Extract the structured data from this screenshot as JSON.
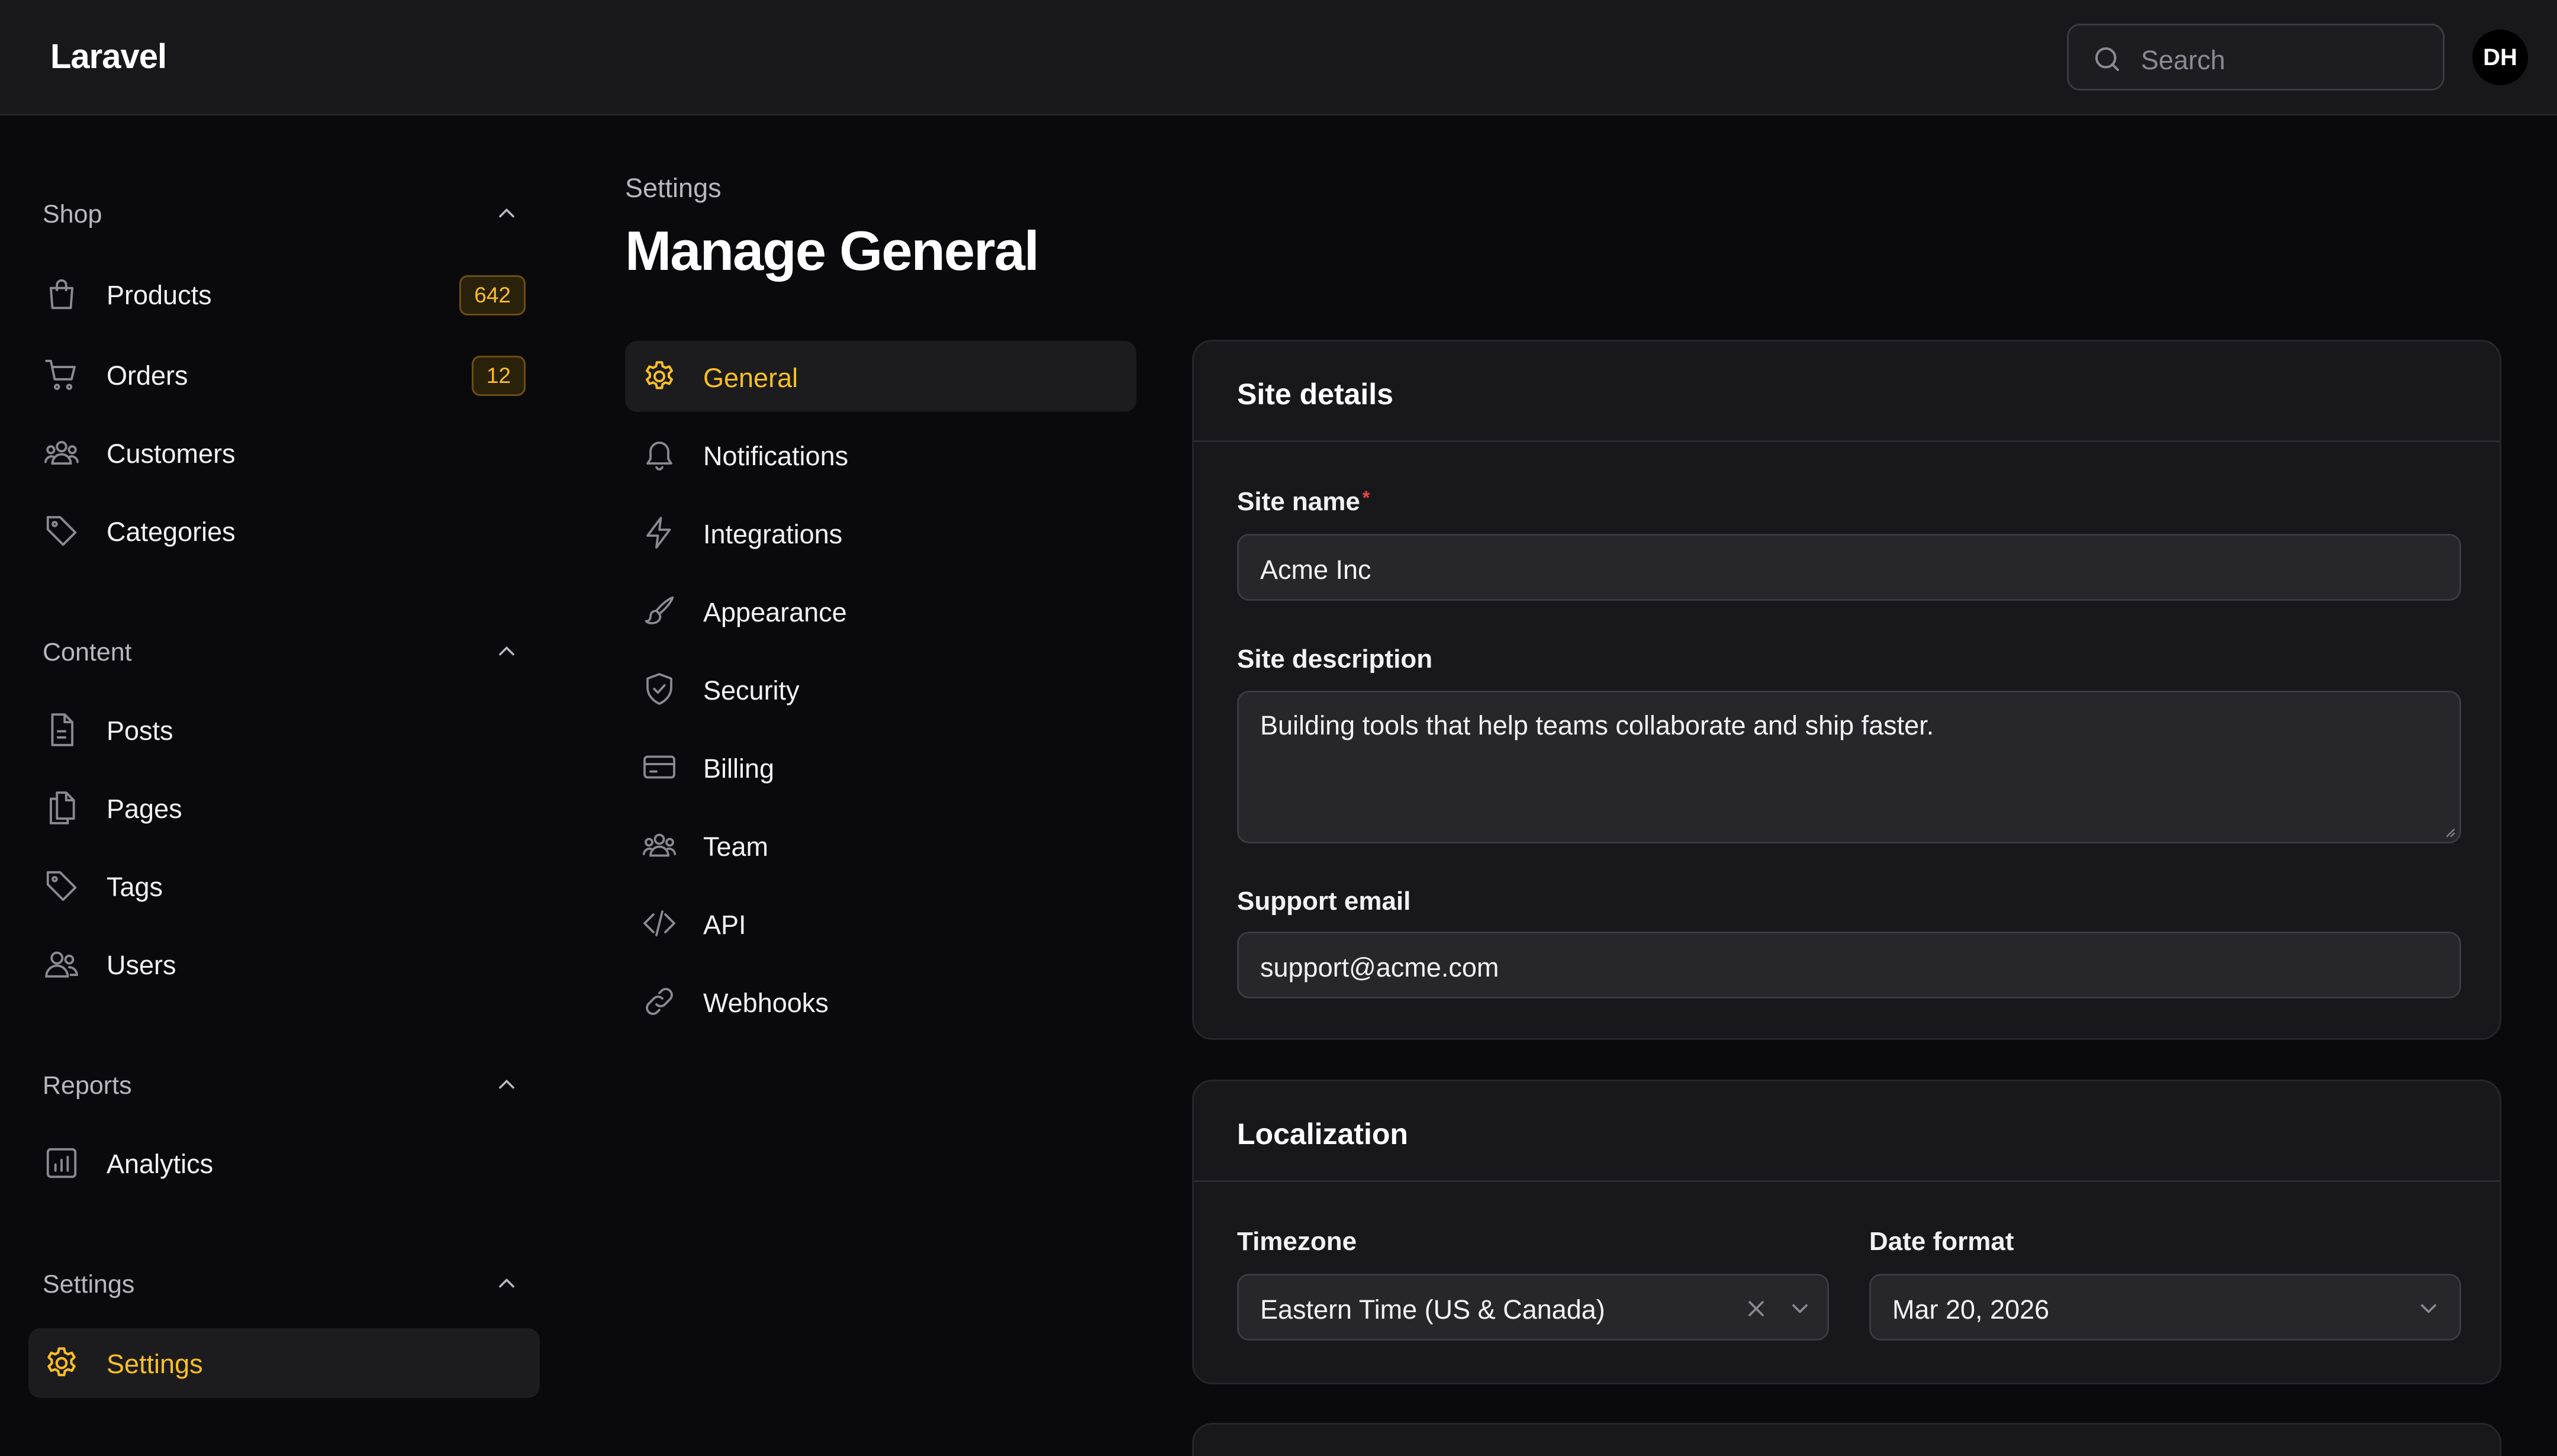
{
  "app": {
    "brand": "Laravel",
    "user_initials": "DH"
  },
  "search": {
    "placeholder": "Search"
  },
  "colors": {
    "accent": "#fbbf24",
    "background": "#0a0a0c",
    "panel": "#18181b",
    "input": "#27272a",
    "required": "#ef4444"
  },
  "sidebar": {
    "groups": [
      {
        "title": "Shop",
        "items": [
          {
            "label": "Products",
            "icon": "shopping-bag-icon",
            "badge": "642"
          },
          {
            "label": "Orders",
            "icon": "shopping-cart-icon",
            "badge": "12"
          },
          {
            "label": "Customers",
            "icon": "users-group-icon"
          },
          {
            "label": "Categories",
            "icon": "tag-icon"
          }
        ]
      },
      {
        "title": "Content",
        "items": [
          {
            "label": "Posts",
            "icon": "document-icon"
          },
          {
            "label": "Pages",
            "icon": "documents-icon"
          },
          {
            "label": "Tags",
            "icon": "tag-icon"
          },
          {
            "label": "Users",
            "icon": "users-icon"
          }
        ]
      },
      {
        "title": "Reports",
        "items": [
          {
            "label": "Analytics",
            "icon": "chart-bar-icon"
          }
        ]
      },
      {
        "title": "Settings",
        "items": [
          {
            "label": "Settings",
            "icon": "gear-icon",
            "active": true
          }
        ]
      }
    ]
  },
  "page": {
    "breadcrumb": "Settings",
    "title": "Manage General"
  },
  "subnav": [
    {
      "label": "General",
      "icon": "gear-icon",
      "active": true
    },
    {
      "label": "Notifications",
      "icon": "bell-icon"
    },
    {
      "label": "Integrations",
      "icon": "bolt-icon"
    },
    {
      "label": "Appearance",
      "icon": "paint-brush-icon"
    },
    {
      "label": "Security",
      "icon": "shield-check-icon"
    },
    {
      "label": "Billing",
      "icon": "credit-card-icon"
    },
    {
      "label": "Team",
      "icon": "users-group-icon"
    },
    {
      "label": "API",
      "icon": "code-icon"
    },
    {
      "label": "Webhooks",
      "icon": "link-icon"
    }
  ],
  "site_details": {
    "heading": "Site details",
    "site_name": {
      "label": "Site name",
      "value": "Acme Inc",
      "required": true
    },
    "site_description": {
      "label": "Site description",
      "value": "Building tools that help teams collaborate and ship faster."
    },
    "support_email": {
      "label": "Support email",
      "value": "support@acme.com"
    }
  },
  "localization": {
    "heading": "Localization",
    "timezone": {
      "label": "Timezone",
      "value": "Eastern Time (US & Canada)"
    },
    "date_format": {
      "label": "Date format",
      "value": "Mar 20, 2026"
    }
  }
}
